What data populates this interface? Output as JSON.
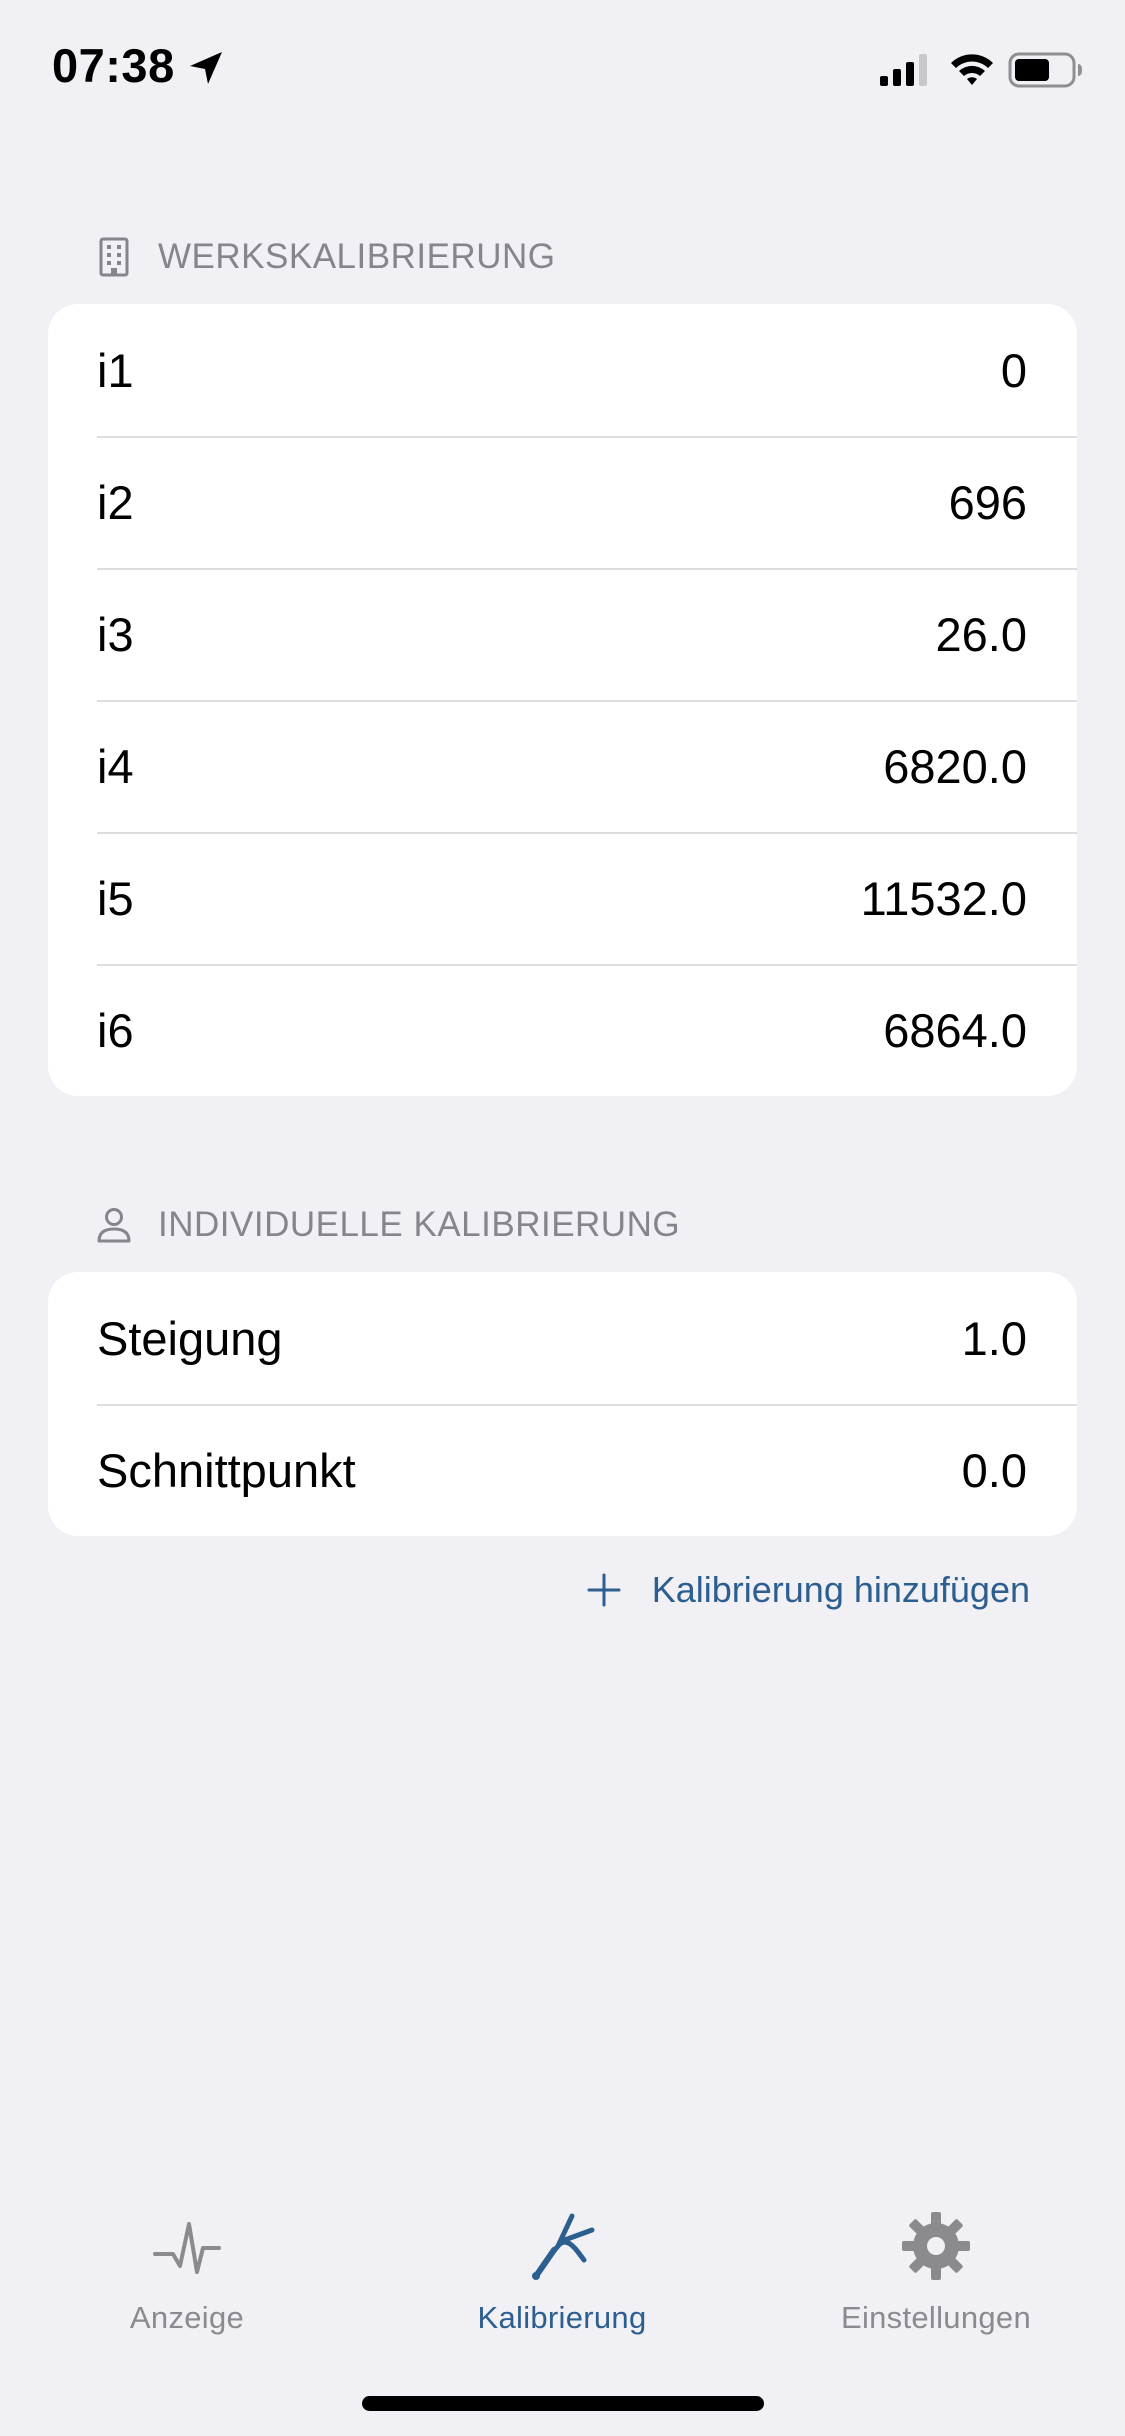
{
  "status_bar": {
    "time": "07:38"
  },
  "factory_section": {
    "title": "WERKSKALIBRIERUNG",
    "icon": "building-icon",
    "rows": [
      {
        "label": "i1",
        "value": "0"
      },
      {
        "label": "i2",
        "value": "696"
      },
      {
        "label": "i3",
        "value": "26.0"
      },
      {
        "label": "i4",
        "value": "6820.0"
      },
      {
        "label": "i5",
        "value": "11532.0"
      },
      {
        "label": "i6",
        "value": "6864.0"
      }
    ]
  },
  "individual_section": {
    "title": "INDIVIDUELLE KALIBRIERUNG",
    "icon": "person-icon",
    "rows": [
      {
        "label": "Steigung",
        "value": "1.0"
      },
      {
        "label": "Schnittpunkt",
        "value": "0.0"
      }
    ]
  },
  "add_calibration": {
    "label": "Kalibrierung hinzufügen",
    "icon": "plus-icon"
  },
  "tab_bar": {
    "active_tab": "Kalibrierung",
    "tabs": [
      {
        "label": "Anzeige",
        "icon": "waveform-icon"
      },
      {
        "label": "Kalibrierung",
        "icon": "tuning-fork-icon"
      },
      {
        "label": "Einstellungen",
        "icon": "gear-icon"
      }
    ]
  },
  "colors": {
    "background": "#f0f0f5",
    "accent": "#2c5e8f",
    "secondary_text": "#85858b",
    "inactive_tab": "#8a8a8f"
  }
}
